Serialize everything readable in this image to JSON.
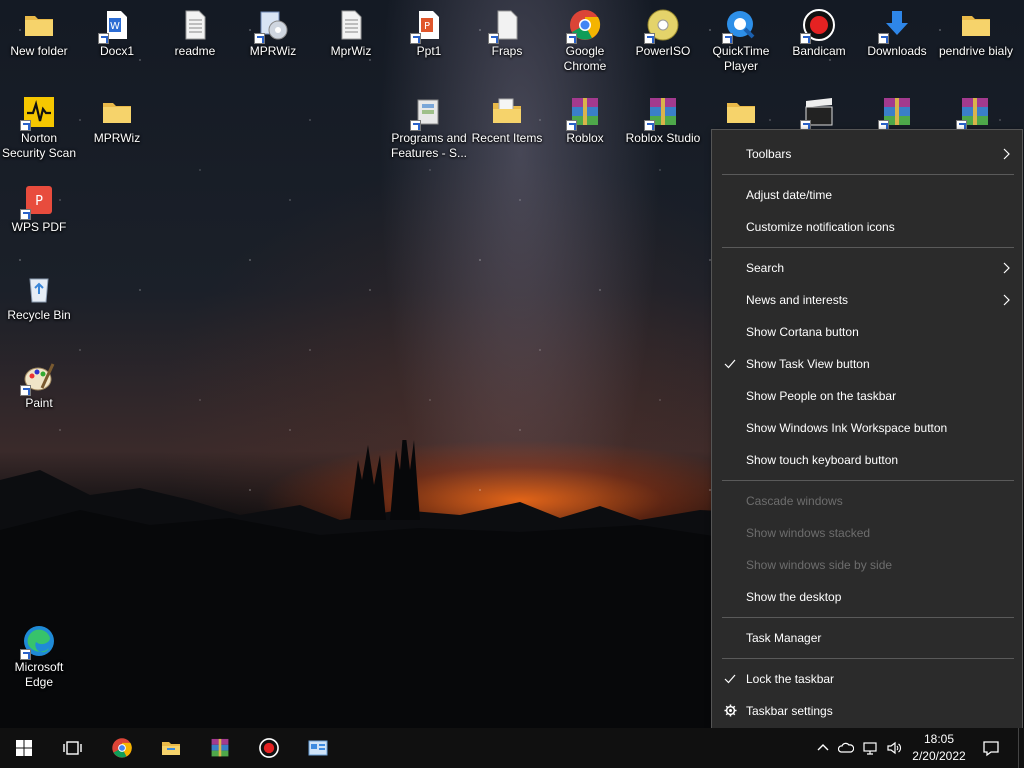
{
  "desktop": {
    "icons": [
      {
        "label": "New folder",
        "icon": "folder-icon"
      },
      {
        "label": "Docx1",
        "icon": "word-document-icon"
      },
      {
        "label": "readme",
        "icon": "text-file-icon"
      },
      {
        "label": "MPRWiz",
        "icon": "mprwiz-app-icon"
      },
      {
        "label": "MprWiz",
        "icon": "text-file-icon"
      },
      {
        "label": "Ppt1",
        "icon": "powerpoint-document-icon"
      },
      {
        "label": "Fraps",
        "icon": "fraps-icon"
      },
      {
        "label": "Google Chrome",
        "icon": "chrome-icon"
      },
      {
        "label": "PowerISO",
        "icon": "poweriso-disc-icon"
      },
      {
        "label": "QuickTime Player",
        "icon": "quicktime-icon"
      },
      {
        "label": "Bandicam",
        "icon": "bandicam-icon"
      },
      {
        "label": "Downloads",
        "icon": "downloads-icon"
      },
      {
        "label": "pendrive bialy",
        "icon": "folder-icon"
      },
      {
        "label": "Norton Security Scan",
        "icon": "norton-icon"
      },
      {
        "label": "MPRWiz",
        "icon": "folder-icon"
      },
      {
        "label": "Programs and Features - S...",
        "icon": "programs-features-icon"
      },
      {
        "label": "Recent Items",
        "icon": "recent-items-icon"
      },
      {
        "label": "Roblox",
        "icon": "winrar-archive-icon"
      },
      {
        "label": "Roblox Studio",
        "icon": "winrar-archive-icon"
      },
      {
        "label": "",
        "icon": "folder-icon"
      },
      {
        "label": "",
        "icon": "clapperboard-icon"
      },
      {
        "label": "",
        "icon": "winrar-archive-icon"
      },
      {
        "label": "",
        "icon": "winrar-archive-icon"
      },
      {
        "label": "WPS PDF",
        "icon": "wps-pdf-icon"
      },
      {
        "label": "Recycle Bin",
        "icon": "recycle-bin-icon"
      },
      {
        "label": "Paint",
        "icon": "paint-icon"
      },
      {
        "label": "Microsoft Edge",
        "icon": "edge-icon"
      }
    ]
  },
  "context_menu": {
    "items": [
      {
        "label": "Toolbars",
        "submenu": true
      },
      {
        "label": "Adjust date/time"
      },
      {
        "label": "Customize notification icons"
      },
      {
        "label": "Search",
        "submenu": true
      },
      {
        "label": "News and interests",
        "submenu": true
      },
      {
        "label": "Show Cortana button"
      },
      {
        "label": "Show Task View button",
        "checked": true
      },
      {
        "label": "Show People on the taskbar"
      },
      {
        "label": "Show Windows Ink Workspace button"
      },
      {
        "label": "Show touch keyboard button"
      },
      {
        "label": "Cascade windows",
        "disabled": true
      },
      {
        "label": "Show windows stacked",
        "disabled": true
      },
      {
        "label": "Show windows side by side",
        "disabled": true
      },
      {
        "label": "Show the desktop"
      },
      {
        "label": "Task Manager"
      },
      {
        "label": "Lock the taskbar",
        "checked": true
      },
      {
        "label": "Taskbar settings",
        "icon": "gear-icon"
      }
    ]
  },
  "taskbar": {
    "pinned": [
      "start-icon",
      "task-view-icon",
      "chrome-icon",
      "file-explorer-icon",
      "winrar-icon",
      "bandicam-icon",
      "control-panel-icon"
    ],
    "tray": [
      "chevron-up-icon",
      "onedrive-icon",
      "network-icon",
      "volume-icon"
    ],
    "time": "18:05",
    "date": "2/20/2022"
  },
  "colors": {
    "menu_bg": "#2b2b2b",
    "menu_separator": "#5a5a5a",
    "menu_disabled_text": "#6d6d6d",
    "taskbar_bg": "#101010"
  }
}
